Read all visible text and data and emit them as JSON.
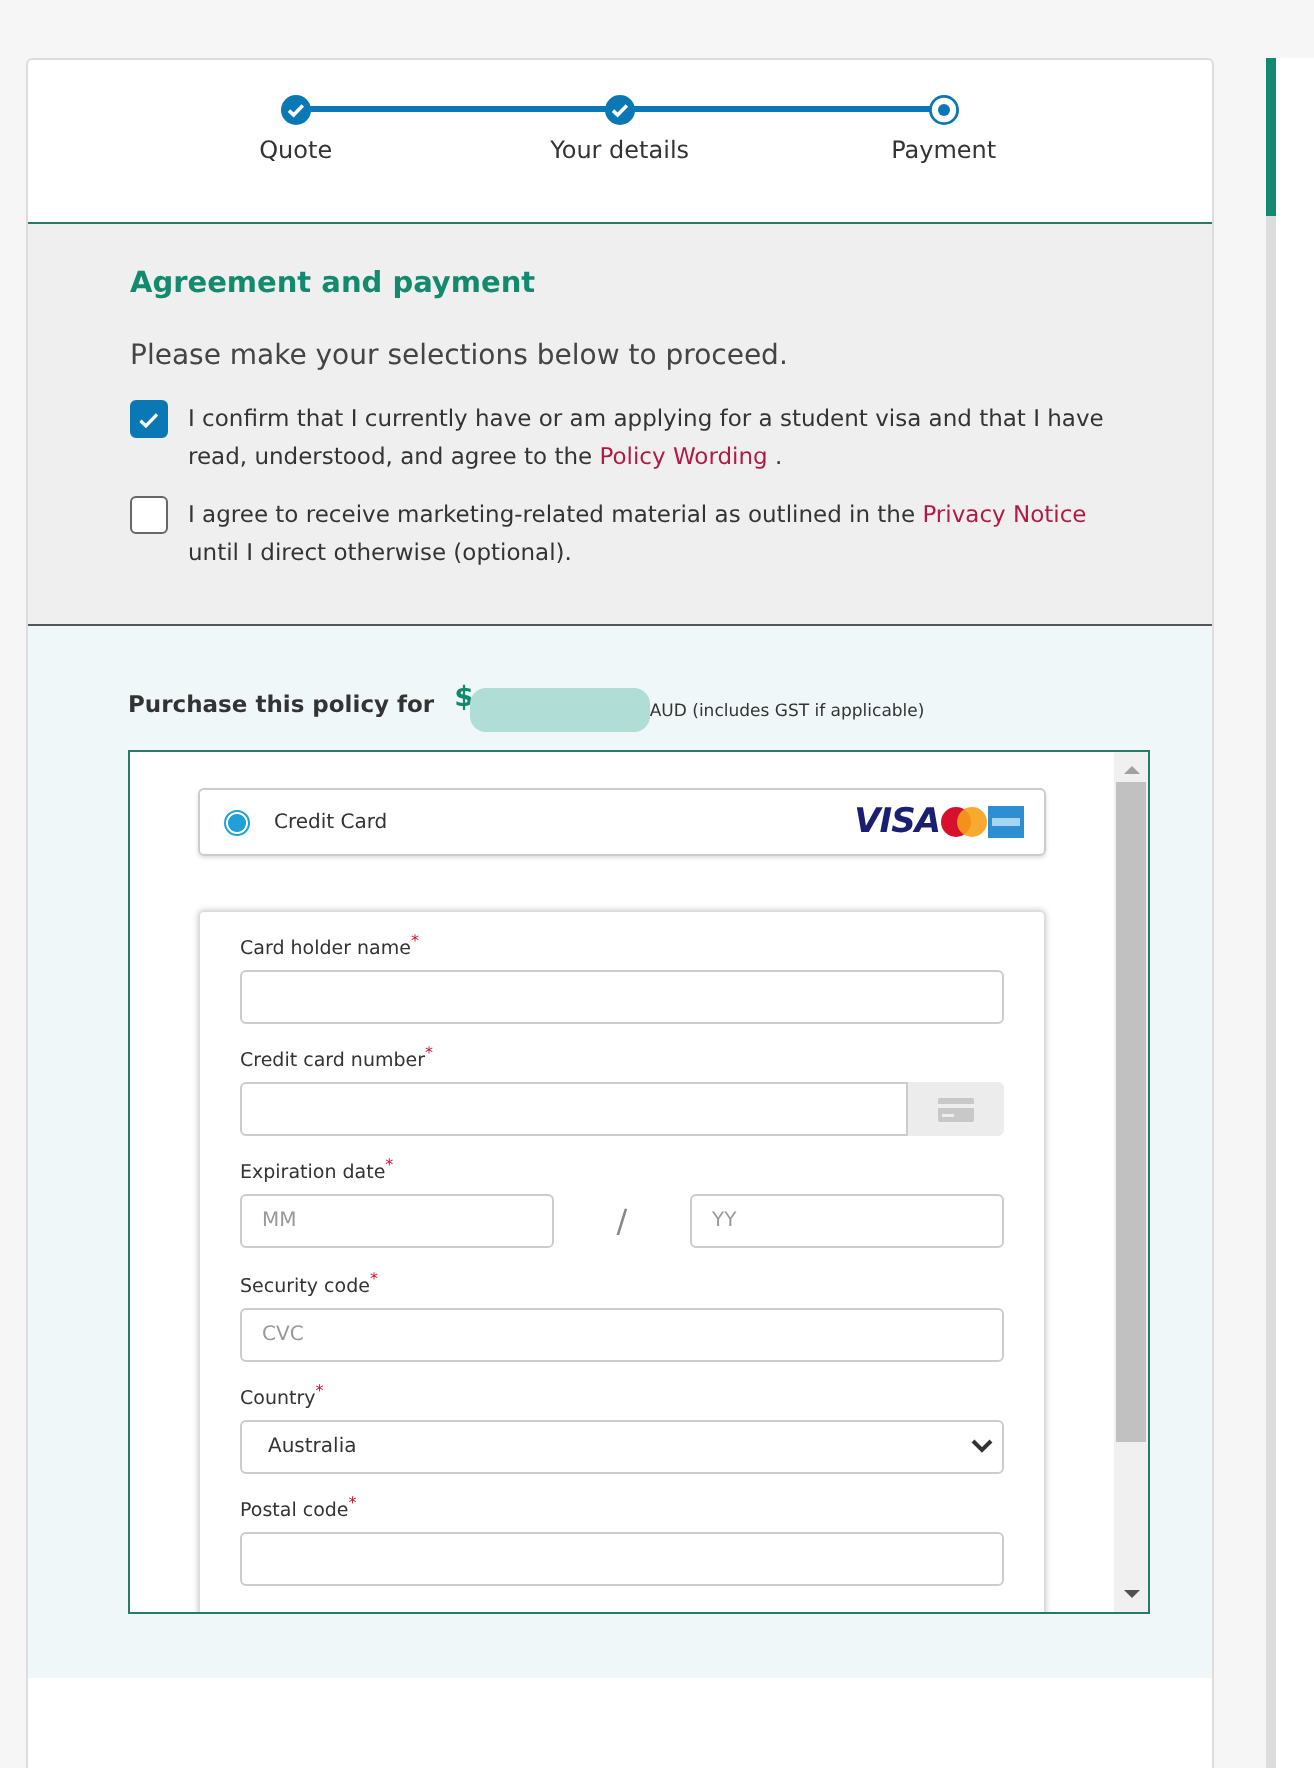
{
  "steps": [
    {
      "label": "Quote",
      "completed": true
    },
    {
      "label": "Your details",
      "completed": true
    },
    {
      "label": "Payment",
      "completed": false
    }
  ],
  "agreement": {
    "title": "Agreement and payment",
    "instruction": "Please make your selections below to proceed.",
    "checkboxes": [
      {
        "checked": true,
        "before": "I confirm that I currently have or am applying for a student visa and that I have read, understood, and agree to the ",
        "link": "Policy Wording",
        "after": " ."
      },
      {
        "checked": false,
        "before": "I agree to receive marketing-related material as outlined in the ",
        "link": "Privacy Notice",
        "after": " until I direct otherwise (optional)."
      }
    ]
  },
  "purchase": {
    "label": "Purchase this policy for",
    "currency": "$",
    "note": "AUD (includes GST if applicable)"
  },
  "payment": {
    "method": {
      "label": "Credit Card",
      "selected": true,
      "logo_text": "VISA"
    },
    "fields": [
      {
        "kind": "text",
        "label": "Card holder name$^{*}$"
      },
      {
        "kind": "card",
        "label": "Credit card number$^{*}$"
      },
      {
        "kind": "expiry",
        "label": "Expiration date$^{*}$",
        "placeholders": [
          "MM",
          "YY"
        ],
        "separator": "/"
      },
      {
        "kind": "text",
        "label": "Security code$^{*}$",
        "placeholder": "CVC"
      },
      {
        "kind": "select",
        "label": "Country$^{*}$",
        "value": "Australia"
      },
      {
        "kind": "text",
        "label": "Postal code$^{*}$"
      }
    ]
  }
}
